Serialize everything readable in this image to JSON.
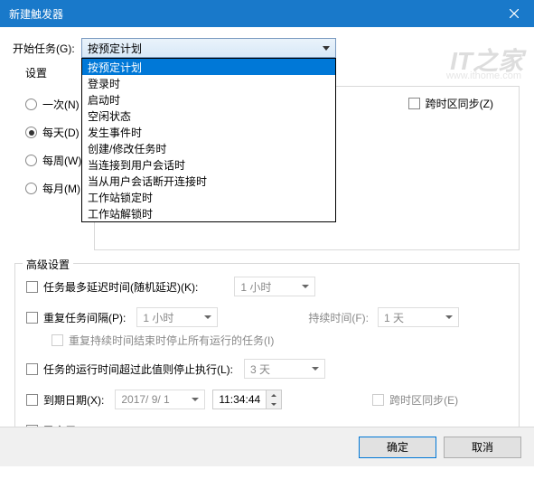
{
  "window": {
    "title": "新建触发器"
  },
  "watermark": {
    "main": "IT之家",
    "sub": "www.ithome.com"
  },
  "begin": {
    "label": "开始任务(G):",
    "selected": "按预定计划",
    "options": [
      "按预定计划",
      "登录时",
      "启动时",
      "空闲状态",
      "发生事件时",
      "创建/修改任务时",
      "当连接到用户会话时",
      "当从用户会话断开连接时",
      "工作站锁定时",
      "工作站解锁时"
    ]
  },
  "settings": {
    "label": "设置",
    "radios": {
      "once": "一次(N)",
      "daily": "每天(D)",
      "weekly": "每周(W)",
      "monthly": "每月(M)"
    },
    "selected": "daily",
    "tz_sync": "跨时区同步(Z)"
  },
  "advanced": {
    "legend": "高级设置",
    "delay": {
      "label": "任务最多延迟时间(随机延迟)(K):",
      "value": "1 小时"
    },
    "repeat": {
      "label": "重复任务间隔(P):",
      "value": "1 小时",
      "duration_label": "持续时间(F):",
      "duration_value": "1 天",
      "stop_label": "重复持续时间结束时停止所有运行的任务(I)"
    },
    "stop_after": {
      "label": "任务的运行时间超过此值则停止执行(L):",
      "value": "3 天"
    },
    "expire": {
      "label": "到期日期(X):",
      "date": "2017/ 9/ 1",
      "time": "11:34:44",
      "tz": "跨时区同步(E)"
    },
    "enabled": {
      "label": "已启用(B)"
    }
  },
  "buttons": {
    "ok": "确定",
    "cancel": "取消"
  }
}
